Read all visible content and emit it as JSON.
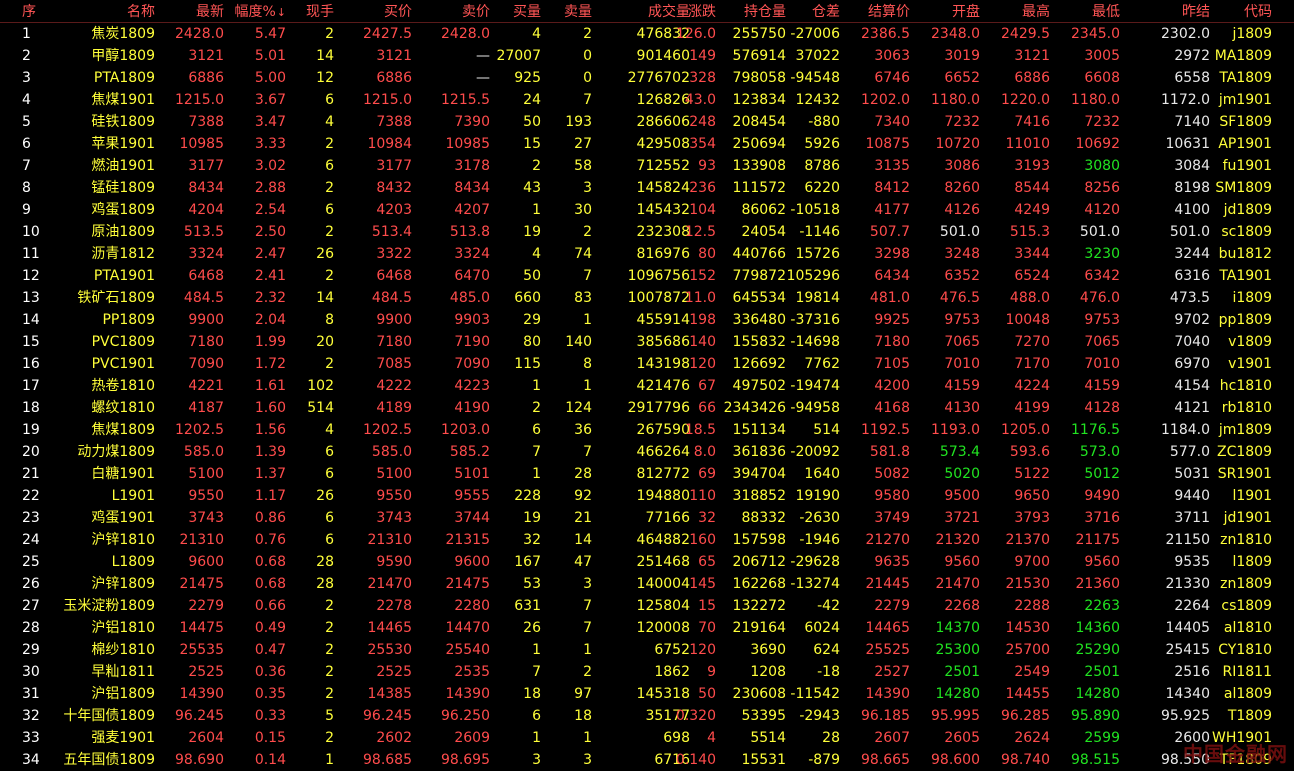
{
  "columns": [
    {
      "key": "seq",
      "label": "序"
    },
    {
      "key": "name",
      "label": "名称"
    },
    {
      "key": "last",
      "label": "最新"
    },
    {
      "key": "pct",
      "label": "幅度%"
    },
    {
      "key": "vol_now",
      "label": "现手"
    },
    {
      "key": "bid",
      "label": "买价"
    },
    {
      "key": "ask",
      "label": "卖价"
    },
    {
      "key": "bid_vol",
      "label": "买量"
    },
    {
      "key": "ask_vol",
      "label": "卖量"
    },
    {
      "key": "volume",
      "label": "成交量"
    },
    {
      "key": "change",
      "label": "涨跌"
    },
    {
      "key": "oi",
      "label": "持仓量"
    },
    {
      "key": "oi_chg",
      "label": "仓差"
    },
    {
      "key": "settle",
      "label": "结算价"
    },
    {
      "key": "open",
      "label": "开盘"
    },
    {
      "key": "high",
      "label": "最高"
    },
    {
      "key": "low",
      "label": "最低"
    },
    {
      "key": "prev_settle",
      "label": "昨结"
    },
    {
      "key": "code",
      "label": "代码"
    }
  ],
  "sort_indicator": "↓",
  "colors": {
    "up": "#ff4c4c",
    "down": "#21e321",
    "flat": "#e8e8e8",
    "yellow": "#ffff3a",
    "header": "#ff5555"
  },
  "rows": [
    {
      "seq": "1",
      "name_cn": "焦炭",
      "name_code": "1809",
      "last": "2428.0",
      "pct": "5.47",
      "vol_now": "2",
      "bid": "2427.5",
      "ask": "2428.0",
      "bid_vol": "4",
      "ask_vol": "2",
      "volume": "476832",
      "change": "126.0",
      "oi": "255750",
      "oi_chg": "-27006",
      "settle": "2386.5",
      "open": "2348.0",
      "high": "2429.5",
      "low": "2345.0",
      "prev_settle": "2302.0",
      "code": "j1809",
      "low_color": "up",
      "open_color": "up"
    },
    {
      "seq": "2",
      "name_cn": "甲醇",
      "name_code": "1809",
      "last": "3121",
      "pct": "5.01",
      "vol_now": "14",
      "bid": "3121",
      "ask": "—",
      "bid_vol": "27007",
      "ask_vol": "0",
      "volume": "901460",
      "change": "149",
      "oi": "576914",
      "oi_chg": "37022",
      "settle": "3063",
      "open": "3019",
      "high": "3121",
      "low": "3005",
      "prev_settle": "2972",
      "code": "MA1809",
      "low_color": "up",
      "open_color": "up"
    },
    {
      "seq": "3",
      "name_cn": "",
      "name_code": "PTA1809",
      "last": "6886",
      "pct": "5.00",
      "vol_now": "12",
      "bid": "6886",
      "ask": "—",
      "bid_vol": "925",
      "ask_vol": "0",
      "volume": "2776702",
      "change": "328",
      "oi": "798058",
      "oi_chg": "-94548",
      "settle": "6746",
      "open": "6652",
      "high": "6886",
      "low": "6608",
      "prev_settle": "6558",
      "code": "TA1809",
      "low_color": "up",
      "open_color": "up"
    },
    {
      "seq": "4",
      "name_cn": "焦煤",
      "name_code": "1901",
      "last": "1215.0",
      "pct": "3.67",
      "vol_now": "6",
      "bid": "1215.0",
      "ask": "1215.5",
      "bid_vol": "24",
      "ask_vol": "7",
      "volume": "126826",
      "change": "43.0",
      "oi": "123834",
      "oi_chg": "12432",
      "settle": "1202.0",
      "open": "1180.0",
      "high": "1220.0",
      "low": "1180.0",
      "prev_settle": "1172.0",
      "code": "jm1901",
      "low_color": "up",
      "open_color": "up"
    },
    {
      "seq": "5",
      "name_cn": "硅铁",
      "name_code": "1809",
      "last": "7388",
      "pct": "3.47",
      "vol_now": "4",
      "bid": "7388",
      "ask": "7390",
      "bid_vol": "50",
      "ask_vol": "193",
      "volume": "286606",
      "change": "248",
      "oi": "208454",
      "oi_chg": "-880",
      "settle": "7340",
      "open": "7232",
      "high": "7416",
      "low": "7232",
      "prev_settle": "7140",
      "code": "SF1809",
      "low_color": "up",
      "open_color": "up"
    },
    {
      "seq": "6",
      "name_cn": "苹果",
      "name_code": "1901",
      "last": "10985",
      "pct": "3.33",
      "vol_now": "2",
      "bid": "10984",
      "ask": "10985",
      "bid_vol": "15",
      "ask_vol": "27",
      "volume": "429508",
      "change": "354",
      "oi": "250694",
      "oi_chg": "5926",
      "settle": "10875",
      "open": "10720",
      "high": "11010",
      "low": "10692",
      "prev_settle": "10631",
      "code": "AP1901",
      "low_color": "up",
      "open_color": "up"
    },
    {
      "seq": "7",
      "name_cn": "燃油",
      "name_code": "1901",
      "last": "3177",
      "pct": "3.02",
      "vol_now": "6",
      "bid": "3177",
      "ask": "3178",
      "bid_vol": "2",
      "ask_vol": "58",
      "volume": "712552",
      "change": "93",
      "oi": "133908",
      "oi_chg": "8786",
      "settle": "3135",
      "open": "3086",
      "high": "3193",
      "low": "3080",
      "prev_settle": "3084",
      "code": "fu1901",
      "low_color": "dn",
      "open_color": "up"
    },
    {
      "seq": "8",
      "name_cn": "锰硅",
      "name_code": "1809",
      "last": "8434",
      "pct": "2.88",
      "vol_now": "2",
      "bid": "8432",
      "ask": "8434",
      "bid_vol": "43",
      "ask_vol": "3",
      "volume": "145824",
      "change": "236",
      "oi": "111572",
      "oi_chg": "6220",
      "settle": "8412",
      "open": "8260",
      "high": "8544",
      "low": "8256",
      "prev_settle": "8198",
      "code": "SM1809",
      "low_color": "up",
      "open_color": "up"
    },
    {
      "seq": "9",
      "name_cn": "鸡蛋",
      "name_code": "1809",
      "last": "4204",
      "pct": "2.54",
      "vol_now": "6",
      "bid": "4203",
      "ask": "4207",
      "bid_vol": "1",
      "ask_vol": "30",
      "volume": "145432",
      "change": "104",
      "oi": "86062",
      "oi_chg": "-10518",
      "settle": "4177",
      "open": "4126",
      "high": "4249",
      "low": "4120",
      "prev_settle": "4100",
      "code": "jd1809",
      "low_color": "up",
      "open_color": "up"
    },
    {
      "seq": "10",
      "name_cn": "原油",
      "name_code": "1809",
      "last": "513.5",
      "pct": "2.50",
      "vol_now": "2",
      "bid": "513.4",
      "ask": "513.8",
      "bid_vol": "19",
      "ask_vol": "2",
      "volume": "232308",
      "change": "12.5",
      "oi": "24054",
      "oi_chg": "-1146",
      "settle": "507.7",
      "open": "501.0",
      "high": "515.3",
      "low": "501.0",
      "prev_settle": "501.0",
      "code": "sc1809",
      "low_color": "fl",
      "open_color": "fl"
    },
    {
      "seq": "11",
      "name_cn": "沥青",
      "name_code": "1812",
      "last": "3324",
      "pct": "2.47",
      "vol_now": "26",
      "bid": "3322",
      "ask": "3324",
      "bid_vol": "4",
      "ask_vol": "74",
      "volume": "816976",
      "change": "80",
      "oi": "440766",
      "oi_chg": "15726",
      "settle": "3298",
      "open": "3248",
      "high": "3344",
      "low": "3230",
      "prev_settle": "3244",
      "code": "bu1812",
      "low_color": "dn",
      "open_color": "up"
    },
    {
      "seq": "12",
      "name_cn": "",
      "name_code": "PTA1901",
      "last": "6468",
      "pct": "2.41",
      "vol_now": "2",
      "bid": "6468",
      "ask": "6470",
      "bid_vol": "50",
      "ask_vol": "7",
      "volume": "1096756",
      "change": "152",
      "oi": "779872",
      "oi_chg": "105296",
      "settle": "6434",
      "open": "6352",
      "high": "6524",
      "low": "6342",
      "prev_settle": "6316",
      "code": "TA1901",
      "low_color": "up",
      "open_color": "up"
    },
    {
      "seq": "13",
      "name_cn": "铁矿石",
      "name_code": "1809",
      "last": "484.5",
      "pct": "2.32",
      "vol_now": "14",
      "bid": "484.5",
      "ask": "485.0",
      "bid_vol": "660",
      "ask_vol": "83",
      "volume": "1007872",
      "change": "11.0",
      "oi": "645534",
      "oi_chg": "19814",
      "settle": "481.0",
      "open": "476.5",
      "high": "488.0",
      "low": "476.0",
      "prev_settle": "473.5",
      "code": "i1809",
      "low_color": "up",
      "open_color": "up"
    },
    {
      "seq": "14",
      "name_cn": "",
      "name_code": "PP1809",
      "last": "9900",
      "pct": "2.04",
      "vol_now": "8",
      "bid": "9900",
      "ask": "9903",
      "bid_vol": "29",
      "ask_vol": "1",
      "volume": "455914",
      "change": "198",
      "oi": "336480",
      "oi_chg": "-37316",
      "settle": "9925",
      "open": "9753",
      "high": "10048",
      "low": "9753",
      "prev_settle": "9702",
      "code": "pp1809",
      "low_color": "up",
      "open_color": "up"
    },
    {
      "seq": "15",
      "name_cn": "",
      "name_code": "PVC1809",
      "last": "7180",
      "pct": "1.99",
      "vol_now": "20",
      "bid": "7180",
      "ask": "7190",
      "bid_vol": "80",
      "ask_vol": "140",
      "volume": "385686",
      "change": "140",
      "oi": "155832",
      "oi_chg": "-14698",
      "settle": "7180",
      "open": "7065",
      "high": "7270",
      "low": "7065",
      "prev_settle": "7040",
      "code": "v1809",
      "low_color": "up",
      "open_color": "up"
    },
    {
      "seq": "16",
      "name_cn": "",
      "name_code": "PVC1901",
      "last": "7090",
      "pct": "1.72",
      "vol_now": "2",
      "bid": "7085",
      "ask": "7090",
      "bid_vol": "115",
      "ask_vol": "8",
      "volume": "143198",
      "change": "120",
      "oi": "126692",
      "oi_chg": "7762",
      "settle": "7105",
      "open": "7010",
      "high": "7170",
      "low": "7010",
      "prev_settle": "6970",
      "code": "v1901",
      "low_color": "up",
      "open_color": "up"
    },
    {
      "seq": "17",
      "name_cn": "热卷",
      "name_code": "1810",
      "last": "4221",
      "pct": "1.61",
      "vol_now": "102",
      "bid": "4222",
      "ask": "4223",
      "bid_vol": "1",
      "ask_vol": "1",
      "volume": "421476",
      "change": "67",
      "oi": "497502",
      "oi_chg": "-19474",
      "settle": "4200",
      "open": "4159",
      "high": "4224",
      "low": "4159",
      "prev_settle": "4154",
      "code": "hc1810",
      "low_color": "up",
      "open_color": "up"
    },
    {
      "seq": "18",
      "name_cn": "螺纹",
      "name_code": "1810",
      "last": "4187",
      "pct": "1.60",
      "vol_now": "514",
      "bid": "4189",
      "ask": "4190",
      "bid_vol": "2",
      "ask_vol": "124",
      "volume": "2917796",
      "change": "66",
      "oi": "2343426",
      "oi_chg": "-94958",
      "settle": "4168",
      "open": "4130",
      "high": "4199",
      "low": "4128",
      "prev_settle": "4121",
      "code": "rb1810",
      "low_color": "up",
      "open_color": "up"
    },
    {
      "seq": "19",
      "name_cn": "焦煤",
      "name_code": "1809",
      "last": "1202.5",
      "pct": "1.56",
      "vol_now": "4",
      "bid": "1202.5",
      "ask": "1203.0",
      "bid_vol": "6",
      "ask_vol": "36",
      "volume": "267590",
      "change": "18.5",
      "oi": "151134",
      "oi_chg": "514",
      "settle": "1192.5",
      "open": "1193.0",
      "high": "1205.0",
      "low": "1176.5",
      "prev_settle": "1184.0",
      "code": "jm1809",
      "low_color": "dn",
      "open_color": "up"
    },
    {
      "seq": "20",
      "name_cn": "动力煤",
      "name_code": "1809",
      "last": "585.0",
      "pct": "1.39",
      "vol_now": "6",
      "bid": "585.0",
      "ask": "585.2",
      "bid_vol": "7",
      "ask_vol": "7",
      "volume": "466264",
      "change": "8.0",
      "oi": "361836",
      "oi_chg": "-20092",
      "settle": "581.8",
      "open": "573.4",
      "high": "593.6",
      "low": "573.0",
      "prev_settle": "577.0",
      "code": "ZC1809",
      "low_color": "dn",
      "open_color": "dn"
    },
    {
      "seq": "21",
      "name_cn": "白糖",
      "name_code": "1901",
      "last": "5100",
      "pct": "1.37",
      "vol_now": "6",
      "bid": "5100",
      "ask": "5101",
      "bid_vol": "1",
      "ask_vol": "28",
      "volume": "812772",
      "change": "69",
      "oi": "394704",
      "oi_chg": "1640",
      "settle": "5082",
      "open": "5020",
      "high": "5122",
      "low": "5012",
      "prev_settle": "5031",
      "code": "SR1901",
      "low_color": "dn",
      "open_color": "dn"
    },
    {
      "seq": "22",
      "name_cn": "",
      "name_code": "L1901",
      "last": "9550",
      "pct": "1.17",
      "vol_now": "26",
      "bid": "9550",
      "ask": "9555",
      "bid_vol": "228",
      "ask_vol": "92",
      "volume": "194880",
      "change": "110",
      "oi": "318852",
      "oi_chg": "19190",
      "settle": "9580",
      "open": "9500",
      "high": "9650",
      "low": "9490",
      "prev_settle": "9440",
      "code": "l1901",
      "low_color": "up",
      "open_color": "up"
    },
    {
      "seq": "23",
      "name_cn": "鸡蛋",
      "name_code": "1901",
      "last": "3743",
      "pct": "0.86",
      "vol_now": "6",
      "bid": "3743",
      "ask": "3744",
      "bid_vol": "19",
      "ask_vol": "21",
      "volume": "77166",
      "change": "32",
      "oi": "88332",
      "oi_chg": "-2630",
      "settle": "3749",
      "open": "3721",
      "high": "3793",
      "low": "3716",
      "prev_settle": "3711",
      "code": "jd1901",
      "low_color": "up",
      "open_color": "up"
    },
    {
      "seq": "24",
      "name_cn": "沪锌",
      "name_code": "1810",
      "last": "21310",
      "pct": "0.76",
      "vol_now": "6",
      "bid": "21310",
      "ask": "21315",
      "bid_vol": "32",
      "ask_vol": "14",
      "volume": "464882",
      "change": "160",
      "oi": "157598",
      "oi_chg": "-1946",
      "settle": "21270",
      "open": "21320",
      "high": "21370",
      "low": "21175",
      "prev_settle": "21150",
      "code": "zn1810",
      "low_color": "up",
      "open_color": "up"
    },
    {
      "seq": "25",
      "name_cn": "",
      "name_code": "L1809",
      "last": "9600",
      "pct": "0.68",
      "vol_now": "28",
      "bid": "9590",
      "ask": "9600",
      "bid_vol": "167",
      "ask_vol": "47",
      "volume": "251468",
      "change": "65",
      "oi": "206712",
      "oi_chg": "-29628",
      "settle": "9635",
      "open": "9560",
      "high": "9700",
      "low": "9560",
      "prev_settle": "9535",
      "code": "l1809",
      "low_color": "up",
      "open_color": "up"
    },
    {
      "seq": "26",
      "name_cn": "沪锌",
      "name_code": "1809",
      "last": "21475",
      "pct": "0.68",
      "vol_now": "28",
      "bid": "21470",
      "ask": "21475",
      "bid_vol": "53",
      "ask_vol": "3",
      "volume": "140004",
      "change": "145",
      "oi": "162268",
      "oi_chg": "-13274",
      "settle": "21445",
      "open": "21470",
      "high": "21530",
      "low": "21360",
      "prev_settle": "21330",
      "code": "zn1809",
      "low_color": "up",
      "open_color": "up"
    },
    {
      "seq": "27",
      "name_cn": "玉米淀粉",
      "name_code": "1809",
      "last": "2279",
      "pct": "0.66",
      "vol_now": "2",
      "bid": "2278",
      "ask": "2280",
      "bid_vol": "631",
      "ask_vol": "7",
      "volume": "125804",
      "change": "15",
      "oi": "132272",
      "oi_chg": "-42",
      "settle": "2279",
      "open": "2268",
      "high": "2288",
      "low": "2263",
      "prev_settle": "2264",
      "code": "cs1809",
      "low_color": "dn",
      "open_color": "up"
    },
    {
      "seq": "28",
      "name_cn": "沪铝",
      "name_code": "1810",
      "last": "14475",
      "pct": "0.49",
      "vol_now": "2",
      "bid": "14465",
      "ask": "14470",
      "bid_vol": "26",
      "ask_vol": "7",
      "volume": "120008",
      "change": "70",
      "oi": "219164",
      "oi_chg": "6024",
      "settle": "14465",
      "open": "14370",
      "high": "14530",
      "low": "14360",
      "prev_settle": "14405",
      "code": "al1810",
      "low_color": "dn",
      "open_color": "dn"
    },
    {
      "seq": "29",
      "name_cn": "棉纱",
      "name_code": "1810",
      "last": "25535",
      "pct": "0.47",
      "vol_now": "2",
      "bid": "25530",
      "ask": "25540",
      "bid_vol": "1",
      "ask_vol": "1",
      "volume": "6752",
      "change": "120",
      "oi": "3690",
      "oi_chg": "624",
      "settle": "25525",
      "open": "25300",
      "high": "25700",
      "low": "25290",
      "prev_settle": "25415",
      "code": "CY1810",
      "low_color": "dn",
      "open_color": "dn"
    },
    {
      "seq": "30",
      "name_cn": "早籼",
      "name_code": "1811",
      "last": "2525",
      "pct": "0.36",
      "vol_now": "2",
      "bid": "2525",
      "ask": "2535",
      "bid_vol": "7",
      "ask_vol": "2",
      "volume": "1862",
      "change": "9",
      "oi": "1208",
      "oi_chg": "-18",
      "settle": "2527",
      "open": "2501",
      "high": "2549",
      "low": "2501",
      "prev_settle": "2516",
      "code": "RI1811",
      "low_color": "dn",
      "open_color": "dn"
    },
    {
      "seq": "31",
      "name_cn": "沪铝",
      "name_code": "1809",
      "last": "14390",
      "pct": "0.35",
      "vol_now": "2",
      "bid": "14385",
      "ask": "14390",
      "bid_vol": "18",
      "ask_vol": "97",
      "volume": "145318",
      "change": "50",
      "oi": "230608",
      "oi_chg": "-11542",
      "settle": "14390",
      "open": "14280",
      "high": "14455",
      "low": "14280",
      "prev_settle": "14340",
      "code": "al1809",
      "low_color": "dn",
      "open_color": "dn"
    },
    {
      "seq": "32",
      "name_cn": "十年国债",
      "name_code": "1809",
      "last": "96.245",
      "pct": "0.33",
      "vol_now": "5",
      "bid": "96.245",
      "ask": "96.250",
      "bid_vol": "6",
      "ask_vol": "18",
      "volume": "35177",
      "change": "0.320",
      "oi": "53395",
      "oi_chg": "-2943",
      "settle": "96.185",
      "open": "95.995",
      "high": "96.285",
      "low": "95.890",
      "prev_settle": "95.925",
      "code": "T1809",
      "low_color": "dn",
      "open_color": "up"
    },
    {
      "seq": "33",
      "name_cn": "强麦",
      "name_code": "1901",
      "last": "2604",
      "pct": "0.15",
      "vol_now": "2",
      "bid": "2602",
      "ask": "2609",
      "bid_vol": "1",
      "ask_vol": "1",
      "volume": "698",
      "change": "4",
      "oi": "5514",
      "oi_chg": "28",
      "settle": "2607",
      "open": "2605",
      "high": "2624",
      "low": "2599",
      "prev_settle": "2600",
      "code": "WH1901",
      "low_color": "dn",
      "open_color": "up"
    },
    {
      "seq": "34",
      "name_cn": "五年国债",
      "name_code": "1809",
      "last": "98.690",
      "pct": "0.14",
      "vol_now": "1",
      "bid": "98.685",
      "ask": "98.695",
      "bid_vol": "3",
      "ask_vol": "3",
      "volume": "6716",
      "change": "0.140",
      "oi": "15531",
      "oi_chg": "-879",
      "settle": "98.665",
      "open": "98.600",
      "high": "98.740",
      "low": "98.515",
      "prev_settle": "98.550",
      "code": "TF1809",
      "low_color": "dn",
      "open_color": "up"
    }
  ],
  "watermark": "中国金融网"
}
